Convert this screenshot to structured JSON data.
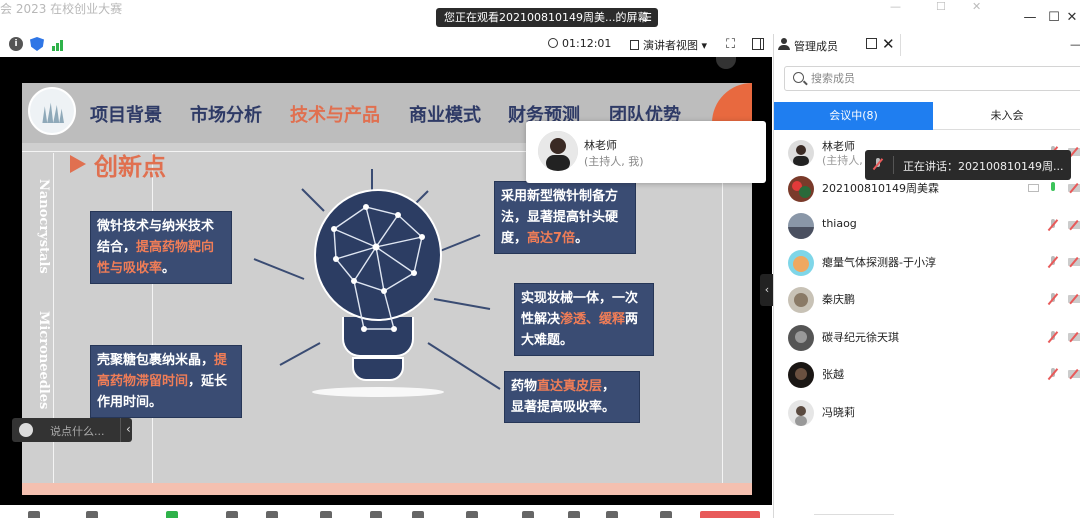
{
  "window": {
    "faint_title": "会 2023 在校创业大赛",
    "share_banner": "您正在观看202100810149周美...的屏幕",
    "share_banner_icon": "list-icon",
    "minimize_glyph": "—",
    "maximize_glyph": "☐",
    "close_glyph": "✕"
  },
  "toolbar": {
    "elapsed": "01:12:01",
    "view_mode": "演讲者视图",
    "view_caret": "▾",
    "fullscreen_glyph": "⛶"
  },
  "slide": {
    "nav": [
      "项目背景",
      "市场分析",
      "技术与产品",
      "商业模式",
      "财务预测",
      "团队优势"
    ],
    "active_nav": "技术与产品",
    "side_text_1": "Nanocrystals",
    "side_text_2": "Microneedles",
    "section_title": "创新点",
    "callouts": [
      {
        "parts": [
          "微针技术与纳米技术",
          "结合，",
          "提高药物靶向",
          "性与吸收率",
          "。"
        ]
      },
      {
        "parts": [
          "采用新型微针制备方",
          "法，显著提高针头硬",
          "度，",
          "高达7倍",
          "。"
        ]
      },
      {
        "parts": [
          "实现妆械一体，一次",
          "性解决",
          "渗透、缓释",
          "两",
          "大难题。"
        ]
      },
      {
        "parts": [
          "壳聚糖包裹纳米晶，",
          "提",
          "高药物滞留时间",
          "，延长",
          "作用时间。"
        ]
      },
      {
        "parts": [
          "药物",
          "直达真皮层",
          "，",
          "显著提高吸收率。"
        ]
      }
    ],
    "highlight_color": "#f07d57",
    "accent_color": "#e07050",
    "navy_color": "#3a4c73"
  },
  "chat": {
    "placeholder": "说点什么...",
    "collapse_glyph": "‹"
  },
  "popup": {
    "name": "林老师",
    "role": "(主持人, 我)"
  },
  "panel": {
    "title": "管理成员",
    "close_glyph": "✕",
    "right_glyph": "—",
    "search_placeholder": "搜索成员",
    "tab_in_meeting": "会议中(8)",
    "tab_not_joined": "未入会",
    "active_tab_color": "#1f7ef0",
    "members": [
      {
        "name": "林老师",
        "sub": "(主持人, 我)",
        "mic": "off"
      },
      {
        "name": "202100810149周美霖",
        "sub": "",
        "mic": "on"
      },
      {
        "name": "thiaog",
        "sub": "",
        "mic": "off"
      },
      {
        "name": "瘪量气体探测器-于小淳",
        "sub": "",
        "mic": "off"
      },
      {
        "name": "秦庆鹏",
        "sub": "",
        "mic": "off"
      },
      {
        "name": "碳寻纪元徐天琪",
        "sub": "",
        "mic": "off"
      },
      {
        "name": "张越",
        "sub": "",
        "mic": "off"
      },
      {
        "name": "冯晓莉",
        "sub": "",
        "mic": "none"
      }
    ],
    "speaking": "正在讲话：202100810149周..."
  },
  "collapse_handle_glyph": "‹"
}
